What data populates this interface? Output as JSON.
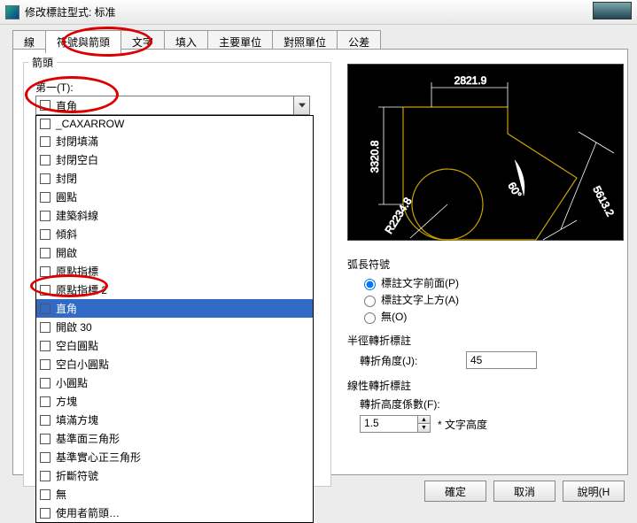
{
  "window": {
    "title": "修改標註型式: 标准"
  },
  "tabs": [
    "線",
    "符號與箭頭",
    "文字",
    "填入",
    "主要單位",
    "對照單位",
    "公差"
  ],
  "activeTab": 1,
  "fieldset": {
    "label": "箭頭",
    "first_label": "第一(T):"
  },
  "combo": {
    "selected": "直角",
    "swatch_icon": "arrow-swatch"
  },
  "dropdown_items": [
    "_CAXARROW",
    "封閉填滿",
    "封閉空白",
    "封閉",
    "圓點",
    "建築斜線",
    "傾斜",
    "開啟",
    "原點指標",
    "原點指標 2",
    "直角",
    "開啟 30",
    "空白圓點",
    "空白小圓點",
    "小圓點",
    "方塊",
    "填滿方塊",
    "基準面三角形",
    "基準實心正三角形",
    "折斷符號",
    "無",
    "使用者箭頭…"
  ],
  "dropdown_selected_index": 10,
  "preview": {
    "top_dim": "2821.9",
    "left_dim": "3320.8",
    "right_dim": "5613.2",
    "radius": "R2234.8",
    "angle": "60°"
  },
  "arc_symbols": {
    "title": "弧長符號",
    "opt1": "標註文字前面(P)",
    "opt2": "標註文字上方(A)",
    "opt3": "無(O)",
    "selected": 0
  },
  "radius_jog": {
    "title": "半徑轉折標註",
    "angle_label": "轉折角度(J):",
    "angle_value": "45"
  },
  "linear_jog": {
    "title": "線性轉折標註",
    "factor_label": "轉折高度係數(F):",
    "factor_value": "1.5",
    "suffix": "* 文字高度"
  },
  "buttons": {
    "ok": "確定",
    "cancel": "取消",
    "help": "說明(H"
  }
}
